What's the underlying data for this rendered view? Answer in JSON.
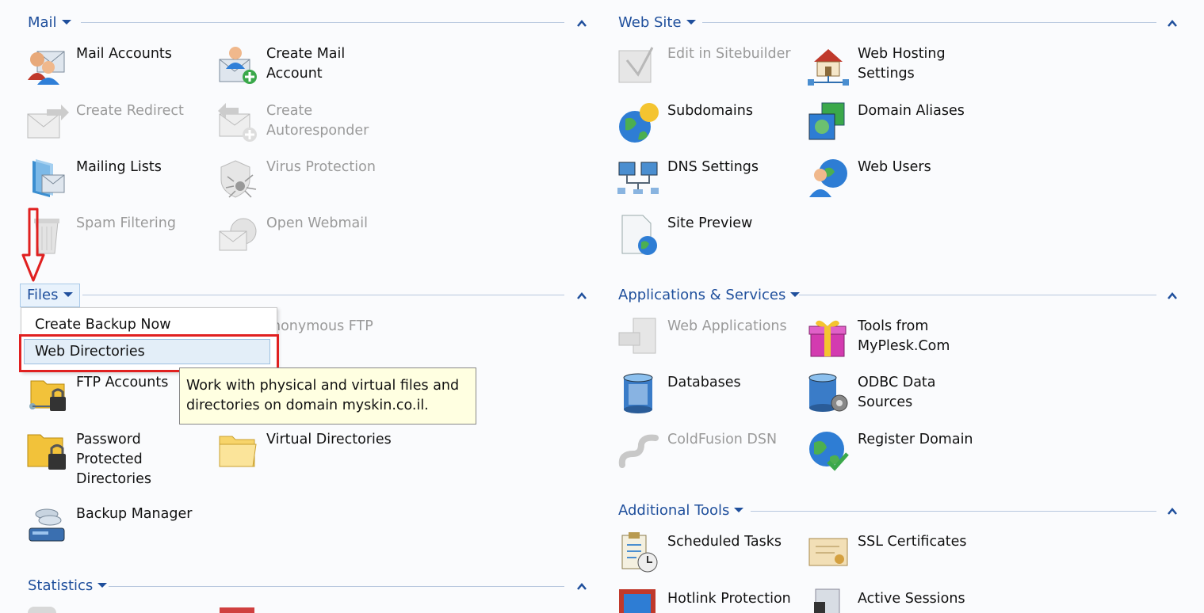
{
  "sections": {
    "mail": {
      "title": "Mail"
    },
    "files": {
      "title": "Files"
    },
    "statistics": {
      "title": "Statistics"
    },
    "web_site": {
      "title": "Web Site"
    },
    "apps": {
      "title": "Applications & Services"
    },
    "tools": {
      "title": "Additional Tools"
    }
  },
  "mail_items": {
    "mail_accounts": "Mail Accounts",
    "create_mail_account_1": "Create Mail",
    "create_mail_account_2": "Account",
    "create_redirect": "Create Redirect",
    "create_autoresponder_1": "Create",
    "create_autoresponder_2": "Autoresponder",
    "mailing_lists": "Mailing Lists",
    "virus_protection": "Virus Protection",
    "spam_filtering": "Spam Filtering",
    "open_webmail": "Open Webmail"
  },
  "files_items": {
    "anonymous_ftp": "nonymous FTP",
    "ftp_accounts": "FTP Accounts",
    "password_dirs_1": "Password",
    "password_dirs_2": "Protected",
    "password_dirs_3": "Directories",
    "virtual_directories": "Virtual Directories",
    "backup_manager": "Backup Manager"
  },
  "files_menu": {
    "create_backup": "Create Backup Now",
    "web_directories": "Web Directories"
  },
  "tooltip": {
    "line1": "Work with physical and virtual files and",
    "line2": "directories on domain myskin.co.il."
  },
  "web_site_items": {
    "edit_sitebuilder": "Edit in Sitebuilder",
    "web_hosting_1": "Web Hosting",
    "web_hosting_2": "Settings",
    "subdomains": "Subdomains",
    "domain_aliases": "Domain Aliases",
    "dns_settings": "DNS Settings",
    "web_users": "Web Users",
    "site_preview": "Site Preview"
  },
  "apps_items": {
    "web_applications": "Web Applications",
    "tools_myplesk_1": "Tools from",
    "tools_myplesk_2": "MyPlesk.Com",
    "databases": "Databases",
    "odbc_1": "ODBC Data",
    "odbc_2": "Sources",
    "coldfusion_dsn": "ColdFusion DSN",
    "register_domain": "Register Domain"
  },
  "tools_items": {
    "scheduled_tasks": "Scheduled Tasks",
    "ssl_certificates": "SSL Certificates",
    "hotlink_protection": "Hotlink Protection",
    "active_sessions": "Active Sessions"
  },
  "colors": {
    "accent": "#1f4f9c",
    "highlight": "#e02020",
    "disabled": "#9a9a9a"
  }
}
